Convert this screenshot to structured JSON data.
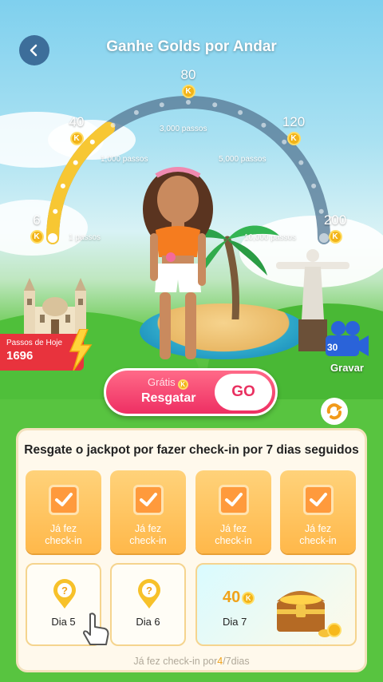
{
  "header": {
    "title": "Ganhe Golds por Andar",
    "back_icon": "chevron-left-icon"
  },
  "gauge": {
    "milestones": [
      {
        "reward": "6",
        "steps": "1 passos"
      },
      {
        "reward": "40",
        "steps": "1,000 passos"
      },
      {
        "reward": "80",
        "steps": "3,000 passos"
      },
      {
        "reward": "120",
        "steps": "5,000 passos"
      },
      {
        "reward": "200",
        "steps": "10,000 passos"
      }
    ],
    "progress_fraction": 0.3,
    "coin_symbol": "K",
    "colors": {
      "fill": "#f7c733",
      "track": "#5a7d98"
    }
  },
  "today_steps": {
    "label": "Passos de Hoje",
    "value": "1696"
  },
  "record": {
    "count": "30",
    "coin_symbol": "K",
    "label": "Gravar"
  },
  "claim": {
    "free_label": "Grátis",
    "action_label": "Resgatar",
    "go_label": "GO"
  },
  "checkin": {
    "title": "Resgate o jackpot por fazer check-in por 7 dias seguidos",
    "done_label_line1": "Já fez",
    "done_label_line2": "check-in",
    "days": [
      {
        "status": "done"
      },
      {
        "status": "done"
      },
      {
        "status": "done"
      },
      {
        "status": "done"
      },
      {
        "status": "pending",
        "label": "Dia 5"
      },
      {
        "status": "pending",
        "label": "Dia 6"
      }
    ],
    "jackpot": {
      "label": "Dia 7",
      "amount": "40",
      "coin_symbol": "K"
    },
    "progress": {
      "prefix": "Já fez check-in por",
      "current": "4",
      "total": "/7dias"
    }
  }
}
